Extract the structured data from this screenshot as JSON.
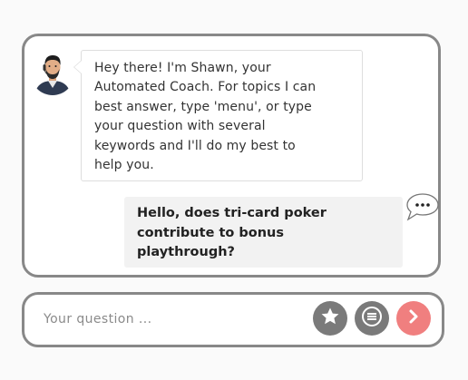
{
  "bot": {
    "avatar_icon": "coach-avatar-icon",
    "message_lines": [
      "Hey there! I'm Shawn, your",
      "Automated Coach. For topics I can",
      "best answer, type 'menu', or type",
      "your question with several",
      "keywords and I'll do my best to",
      "help you."
    ]
  },
  "user": {
    "message_lines": [
      "Hello, does tri-card poker",
      "contribute to bonus",
      "playthrough?"
    ],
    "typing_icon": "speech-bubble-ellipsis-icon"
  },
  "input": {
    "placeholder": "Your question ...",
    "value": ""
  },
  "buttons": {
    "favorite_icon": "star-icon",
    "menu_icon": "hamburger-menu-icon",
    "send_icon": "chevron-right-icon"
  },
  "colors": {
    "panel_border": "#888888",
    "user_bubble_bg": "#f2f2f2",
    "action_button_gray": "#7a7a7a",
    "send_button": "#f07f7f"
  }
}
